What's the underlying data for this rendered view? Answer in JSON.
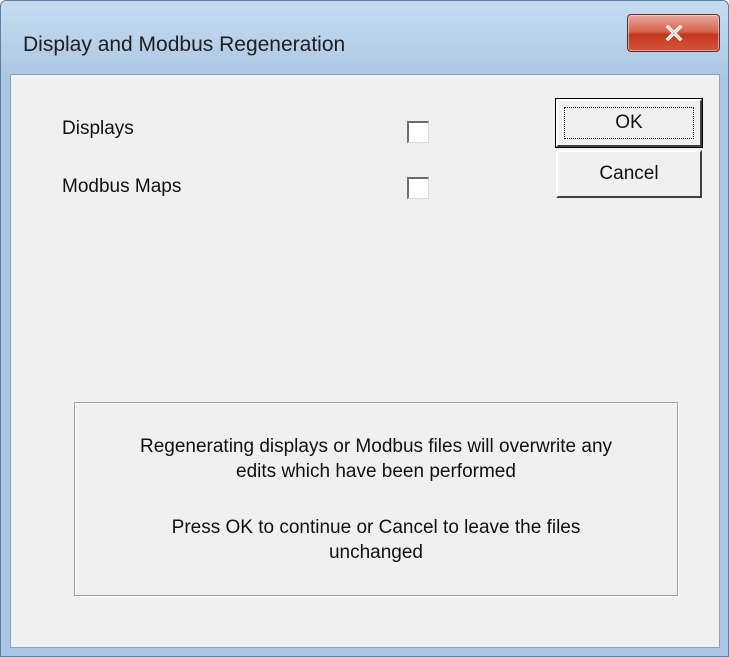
{
  "window": {
    "title": "Display and Modbus Regeneration",
    "close_icon": "close-x-icon"
  },
  "options": {
    "displays_label": "Displays",
    "displays_checked": false,
    "modbus_label": "Modbus Maps",
    "modbus_checked": false
  },
  "buttons": {
    "ok_label": "OK",
    "cancel_label": "Cancel"
  },
  "info": {
    "line1": "Regenerating displays or Modbus files will overwrite any",
    "line2": "edits which have been performed",
    "line3": "Press OK to continue or Cancel to leave the files",
    "line4": "unchanged"
  },
  "colors": {
    "close_button": "#c4381f",
    "dialog_face": "#f0f0f0"
  }
}
